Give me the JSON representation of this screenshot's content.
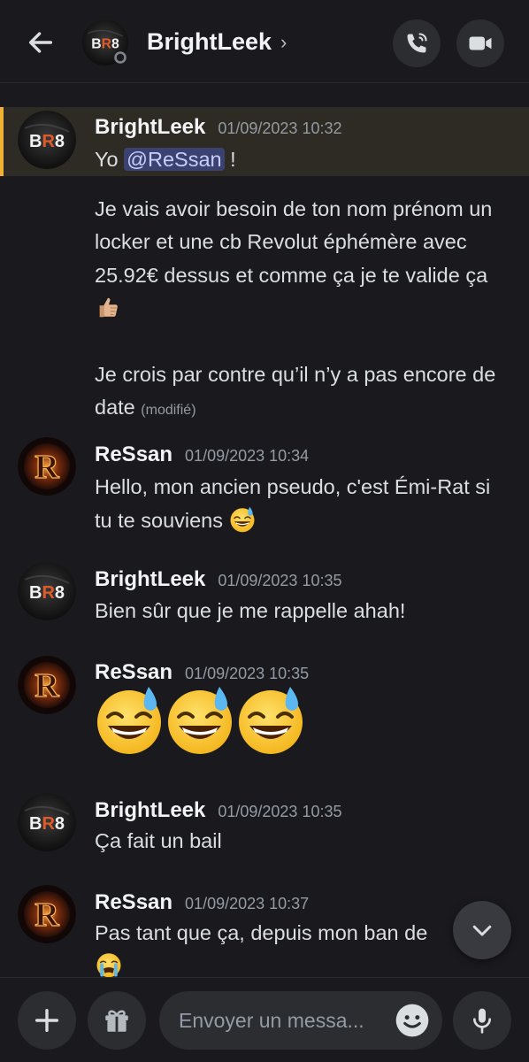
{
  "header": {
    "title": "BrightLeek",
    "chevron": "›"
  },
  "messages": [
    {
      "author": "BrightLeek",
      "timestamp": "01/09/2023 10:32",
      "avatar": "br8-avatar",
      "lines": {
        "yo": "Yo",
        "mention": "@ReSsan",
        "exclaim": " !",
        "p2": "Je vais avoir besoin de ton nom prénom un locker et une cb Revolut éphémère avec 25.92€ dessus et comme ça je te valide ça",
        "p3": "Je crois par contre qu’il n’y a pas encore de date",
        "edited": "(modifié)"
      }
    },
    {
      "author": "ReSsan",
      "timestamp": "01/09/2023 10:34",
      "avatar": "r-avatar",
      "text": "Hello, mon ancien pseudo, c'est Émi-Rat si tu te souviens"
    },
    {
      "author": "BrightLeek",
      "timestamp": "01/09/2023 10:35",
      "avatar": "br8-avatar",
      "text": "Bien sûr que je me rappelle ahah!"
    },
    {
      "author": "ReSsan",
      "timestamp": "01/09/2023 10:35",
      "avatar": "r-avatar",
      "emojis": [
        "sweat-smile",
        "sweat-smile",
        "sweat-smile"
      ]
    },
    {
      "author": "BrightLeek",
      "timestamp": "01/09/2023 10:35",
      "avatar": "br8-avatar",
      "text": "Ça fait un bail"
    },
    {
      "author": "ReSsan",
      "timestamp": "01/09/2023 10:37",
      "avatar": "r-avatar",
      "text": "Pas tant que ça, depuis mon ban de"
    }
  ],
  "composer": {
    "placeholder": "Envoyer un messa..."
  },
  "colors": {
    "background": "#1a1a1e",
    "highlight": "#2e2b25",
    "highlight_bar": "#f0b232",
    "mention_bg": "#3c4270",
    "button_bg": "#2b2d31"
  }
}
